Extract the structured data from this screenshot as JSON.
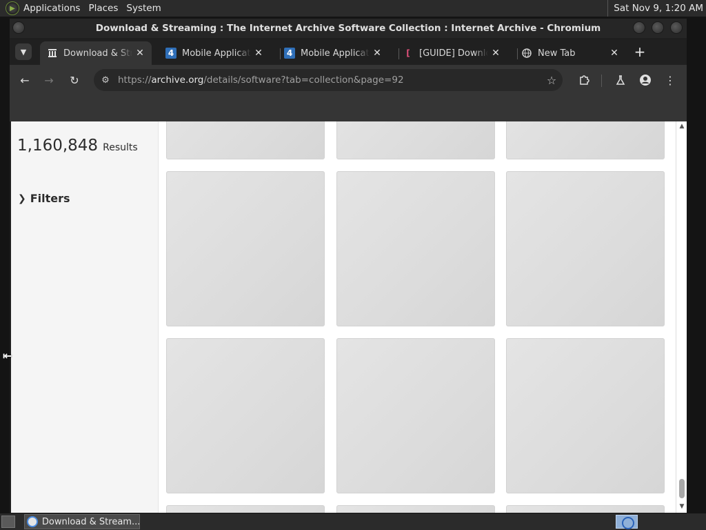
{
  "top_panel": {
    "menus": [
      "Applications",
      "Places",
      "System"
    ],
    "clock": "Sat Nov 9, 1:20 AM"
  },
  "window": {
    "title": "Download & Streaming : The Internet Archive Software Collection : Internet Archive - Chromium"
  },
  "tabs": [
    {
      "title": "Download & Streaming : The Internet Archive Software Collection",
      "favicon": "archive-icon",
      "active": true
    },
    {
      "title": "Mobile Applications",
      "favicon": "4pda-icon",
      "active": false
    },
    {
      "title": "Mobile Applications",
      "favicon": "4pda-icon",
      "active": false
    },
    {
      "title": "[GUIDE] Download",
      "favicon": "guide-icon",
      "active": false
    },
    {
      "title": "New Tab",
      "favicon": "globe-icon",
      "active": false
    }
  ],
  "toolbar": {
    "url_prefix": "https://",
    "url_host": "archive.org",
    "url_path": "/details/software?tab=collection&page=92"
  },
  "page": {
    "results_count": "1,160,848",
    "results_label": "Results",
    "filters_label": "Filters"
  },
  "taskbar": {
    "task_label": "Download & Stream..."
  },
  "colors": {
    "tile_placeholder": "#dcdcdc",
    "sidebar_bg": "#f5f5f5",
    "chrome_toolbar": "#353535"
  }
}
